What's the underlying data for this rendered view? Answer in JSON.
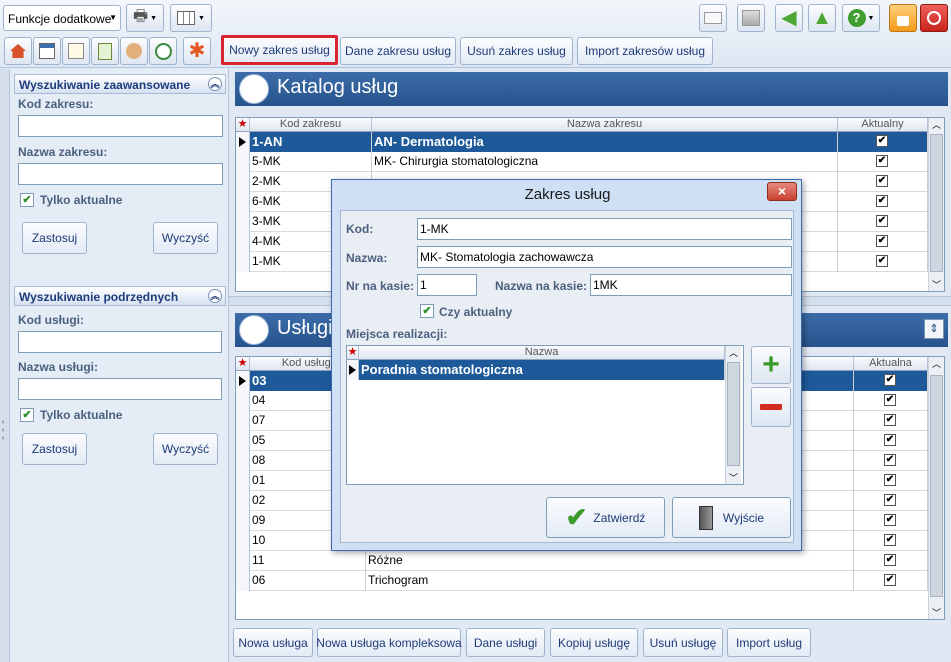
{
  "toolbar": {
    "funkcje": "Funkcje dodatkowe",
    "tabs": [
      "Nowy zakres usług",
      "Dane zakresu usług",
      "Usuń zakres usług",
      "Import zakresów usług"
    ]
  },
  "left": {
    "adv_title": "Wyszukiwanie zaawansowane",
    "kod_zakresu": "Kod zakresu:",
    "nazwa_zakresu": "Nazwa zakresu:",
    "tylko": "Tylko aktualne",
    "zastosuj": "Zastosuj",
    "wyczysc": "Wyczyść",
    "sub_title": "Wyszukiwanie podrzędnych",
    "kod_uslugi": "Kod usługi:",
    "nazwa_uslugi": "Nazwa usługi:"
  },
  "katalog": {
    "title": "Katalog usług",
    "headers": [
      "Kod zakresu",
      "Nazwa zakresu",
      "Aktualny"
    ],
    "rows": [
      {
        "kod": "1-AN",
        "nazwa": "AN- Dermatologia"
      },
      {
        "kod": "5-MK",
        "nazwa": "MK- Chirurgia stomatologiczna"
      },
      {
        "kod": "2-MK",
        "nazwa": ""
      },
      {
        "kod": "6-MK",
        "nazwa": ""
      },
      {
        "kod": "3-MK",
        "nazwa": ""
      },
      {
        "kod": "4-MK",
        "nazwa": ""
      },
      {
        "kod": "1-MK",
        "nazwa": ""
      }
    ]
  },
  "uslugi": {
    "title": "Usługi",
    "headers": [
      "Kod usługi",
      "",
      "Aktualna"
    ],
    "rows": [
      {
        "kod": "03",
        "nazwa": ""
      },
      {
        "kod": "04",
        "nazwa": ""
      },
      {
        "kod": "07",
        "nazwa": ""
      },
      {
        "kod": "05",
        "nazwa": ""
      },
      {
        "kod": "08",
        "nazwa": ""
      },
      {
        "kod": "01",
        "nazwa": ""
      },
      {
        "kod": "02",
        "nazwa": ""
      },
      {
        "kod": "09",
        "nazwa": ""
      },
      {
        "kod": "10",
        "nazwa": ""
      },
      {
        "kod": "11",
        "nazwa": "Różne"
      },
      {
        "kod": "06",
        "nazwa": "Trichogram"
      }
    ]
  },
  "bottom": [
    "Nowa usługa",
    "Nowa usługa kompleksowa",
    "Dane usługi",
    "Kopiuj usługę",
    "Usuń usługę",
    "Import usług"
  ],
  "dialog": {
    "title": "Zakres usług",
    "close": "×",
    "kod_label": "Kod:",
    "kod": "1-MK",
    "nazwa_label": "Nazwa:",
    "nazwa": "MK- Stomatologia zachowawcza",
    "nr_label": "Nr na kasie:",
    "nr": "1",
    "nk_label": "Nazwa na kasie:",
    "nk": "1MK",
    "czy": "Czy aktualny",
    "miejsca": "Miejsca realizacji:",
    "col": "Nazwa",
    "place": "Poradnia stomatologiczna",
    "zatwierdz": "Zatwierdź",
    "wyjscie": "Wyjście"
  },
  "colors": {
    "accent": "#1e5a9a",
    "highlight": "#d9232e"
  }
}
